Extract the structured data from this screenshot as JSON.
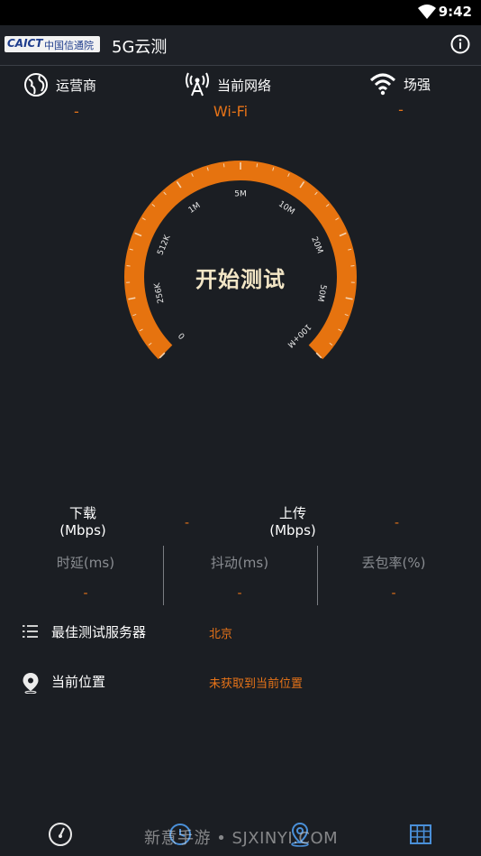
{
  "status_bar": {
    "time": "9:42"
  },
  "app_bar": {
    "logo_latin": "CAICT",
    "logo_cn": "中国信通院",
    "title": "5G云测"
  },
  "info": {
    "carrier": {
      "label": "运营商",
      "value": "-"
    },
    "network": {
      "label": "当前网络",
      "value": "Wi-Fi"
    },
    "signal": {
      "label": "场强",
      "value": "-"
    }
  },
  "gauge": {
    "start_label": "开始测试",
    "ticks": [
      "0",
      "256K",
      "512K",
      "1M",
      "5M",
      "10M",
      "20M",
      "50M",
      "100+M"
    ]
  },
  "speed": {
    "download": {
      "label_line1": "下载",
      "label_line2": "(Mbps)",
      "value": "-"
    },
    "upload": {
      "label_line1": "上传",
      "label_line2": "(Mbps)",
      "value": "-"
    }
  },
  "metrics": [
    {
      "label": "时延(ms)",
      "value": "-"
    },
    {
      "label": "抖动(ms)",
      "value": "-"
    },
    {
      "label": "丢包率(%)",
      "value": "-"
    }
  ],
  "server": {
    "label": "最佳测试服务器",
    "value": "北京"
  },
  "location": {
    "label": "当前位置",
    "value": "未获取到当前位置"
  },
  "watermark": "新意手游 • SJXINYI.COM",
  "colors": {
    "accent": "#e6730f",
    "background": "#1b1e23",
    "bottom_icon": "#4a90d9"
  }
}
